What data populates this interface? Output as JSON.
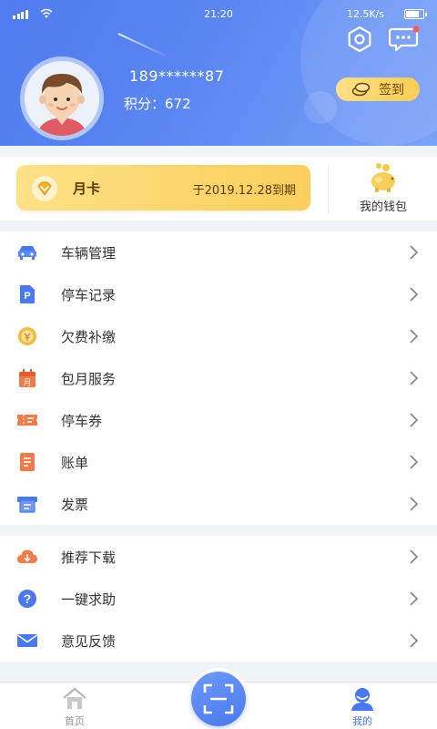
{
  "status_bar": {
    "time": "21:20",
    "network_speed": "12.5K/s",
    "battery_level": 0.85
  },
  "header": {
    "phone": "189******87",
    "points_label": "积分：",
    "points_value": "672",
    "signin_label": "签到",
    "colors": {
      "gradient_start": "#4f7cf0",
      "gradient_end": "#7aa2f8",
      "signin_bg": "#fcd56c"
    }
  },
  "month_card": {
    "label": "月卡",
    "expiry": "于2019.12.28到期"
  },
  "wallet": {
    "label": "我的钱包"
  },
  "menu_group_1": [
    {
      "label": "车辆管理",
      "icon": "car-icon"
    },
    {
      "label": "停车记录",
      "icon": "parking-record-icon"
    },
    {
      "label": "欠费补缴",
      "icon": "arrears-coin-icon"
    },
    {
      "label": "包月服务",
      "icon": "calendar-month-icon"
    },
    {
      "label": "停车券",
      "icon": "ticket-icon"
    },
    {
      "label": "账单",
      "icon": "bill-icon"
    },
    {
      "label": "发票",
      "icon": "invoice-icon"
    }
  ],
  "menu_group_2": [
    {
      "label": "推荐下载",
      "icon": "cloud-download-icon"
    },
    {
      "label": "一键求助",
      "icon": "help-icon"
    },
    {
      "label": "意见反馈",
      "icon": "mail-icon"
    }
  ],
  "tabbar": {
    "home_label": "首页",
    "mine_label": "我的",
    "active_color": "#4a78ee",
    "inactive_color": "#999999"
  }
}
